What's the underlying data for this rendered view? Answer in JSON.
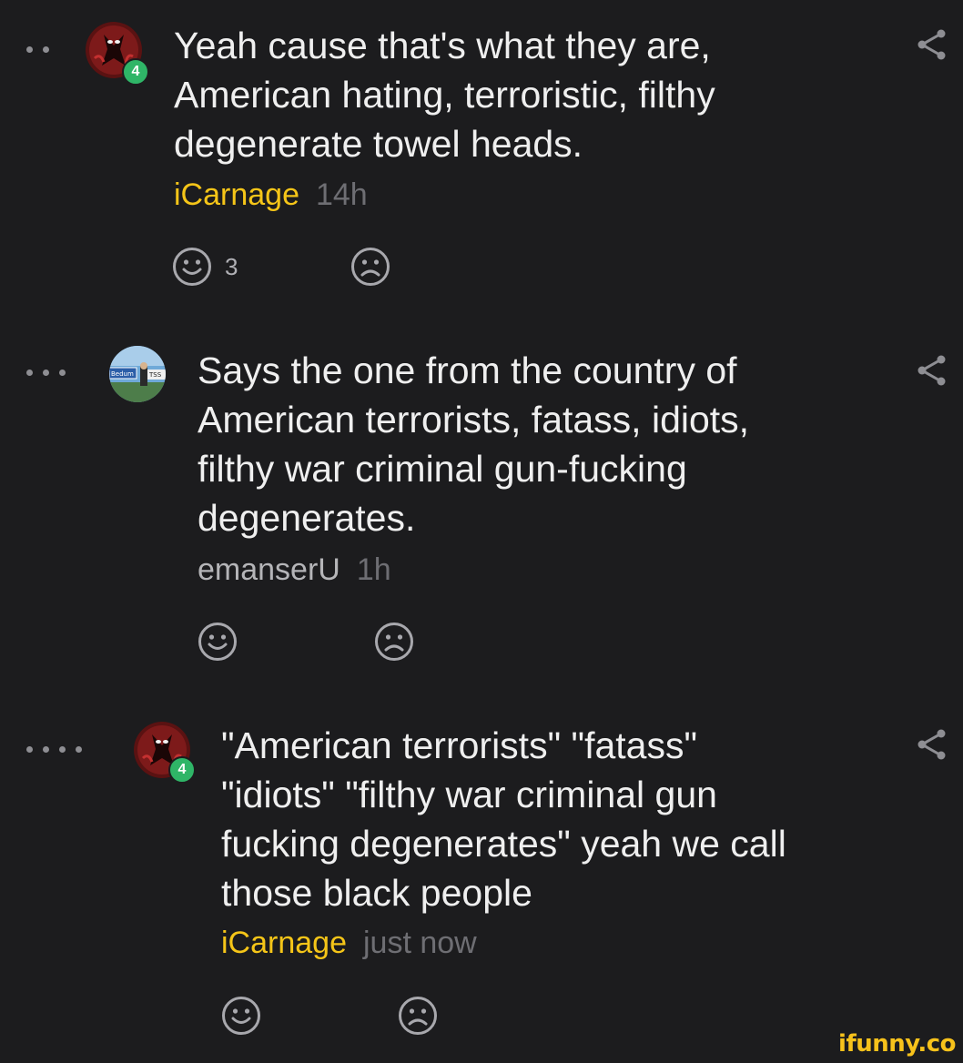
{
  "comments": [
    {
      "text": "Yeah cause that's what they are,\nAmerican hating, terroristic, filthy\ndegenerate towel heads.",
      "username": "iCarnage",
      "time": "14h",
      "level": "4",
      "smile_count": "3"
    },
    {
      "text": "Says the one from the country of\nAmerican terrorists, fatass, idiots,\nfilthy war criminal gun-fucking\ndegenerates.",
      "username": "emanserU",
      "time": "1h",
      "avatar_sign_left": "Bedum",
      "avatar_sign_right": "TSS"
    },
    {
      "text": "\"American terrorists\" \"fatass\"\n\"idiots\" \"filthy war criminal gun\nfucking degenerates\" yeah we call\nthose black people",
      "username": "iCarnage",
      "time": "just now",
      "level": "4"
    }
  ],
  "brand": "ifunny.co",
  "colors": {
    "background": "#1c1c1e",
    "username_highlight": "#f5c518",
    "level_badge": "#2fb567"
  }
}
